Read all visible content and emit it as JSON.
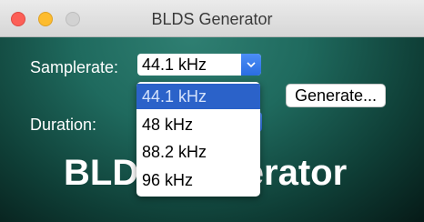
{
  "window": {
    "title": "BLDS Generator",
    "traffic_lights": {
      "close_color": "#fc5f57",
      "minimize_color": "#fdbc2e",
      "zoom_color": "#d2d2d2"
    }
  },
  "form": {
    "samplerate_label": "Samplerate:",
    "samplerate_value": "44.1 kHz",
    "samplerate_options": [
      "44.1 kHz",
      "48 kHz",
      "88.2 kHz",
      "96 kHz"
    ],
    "duration_label": "Duration:",
    "generate_label": "Generate..."
  },
  "branding": {
    "big_title": "BLDS Generator"
  },
  "colors": {
    "selection": "#2b62c9",
    "accent": "#2a6de2",
    "background": "#1f6a5e"
  },
  "icons": {
    "select_arrow": "chevron-down-icon"
  }
}
